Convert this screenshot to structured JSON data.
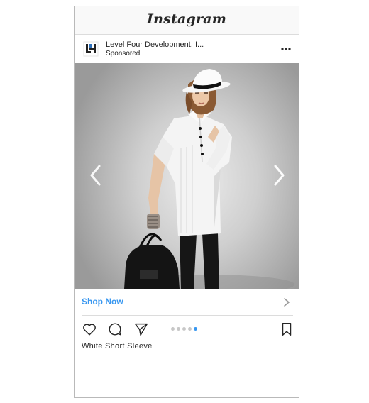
{
  "header": {
    "title": "Instagram"
  },
  "post": {
    "account_name": "Level Four Development, I...",
    "sponsored_label": "Sponsored",
    "logo_text": "LH",
    "cta_label": "Shop Now",
    "caption": "White Short Sleeve",
    "carousel": {
      "total": 5,
      "active_index": 4
    }
  },
  "icons": {
    "more": "more-options-icon",
    "prev": "chevron-left-icon",
    "next": "chevron-right-icon",
    "like": "heart-icon",
    "comment": "comment-icon",
    "share": "share-icon",
    "save": "bookmark-icon"
  },
  "colors": {
    "accent": "#3897f0",
    "text": "#262626",
    "logo_blue": "#2a6ebb"
  }
}
